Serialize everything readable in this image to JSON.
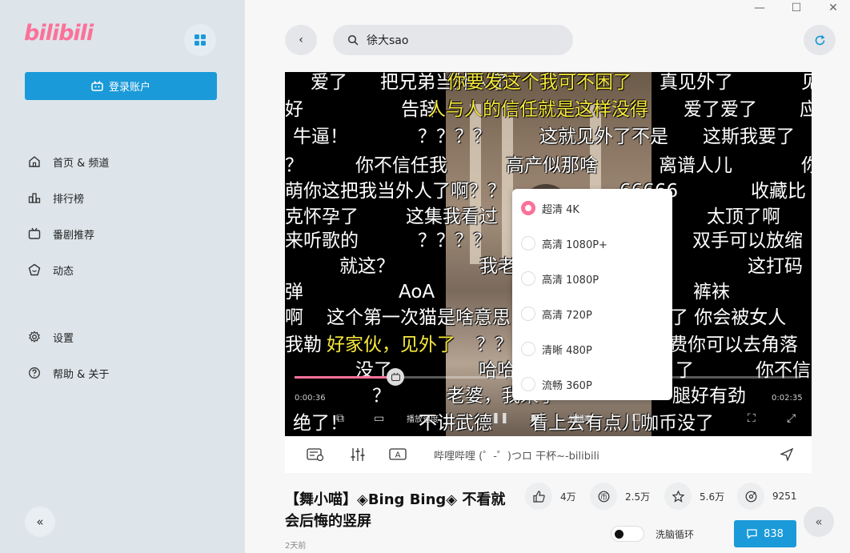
{
  "app": {
    "logo_text": "bilibili",
    "brand_color": "#fb7299",
    "accent_color": "#1a9ad9"
  },
  "sidebar": {
    "login_label": "登录账户",
    "items": [
      {
        "label": "首页 & 频道",
        "icon": "home-icon"
      },
      {
        "label": "排行榜",
        "icon": "ranking-icon"
      },
      {
        "label": "番剧推荐",
        "icon": "tv-icon"
      },
      {
        "label": "动态",
        "icon": "activity-icon"
      },
      {
        "label": "设置",
        "icon": "gear-icon"
      },
      {
        "label": "帮助 & 关于",
        "icon": "help-icon"
      }
    ],
    "collapse_label": "«"
  },
  "window": {
    "minimize": "—",
    "maximize": "☐",
    "close": "✕"
  },
  "header": {
    "back_label": "‹",
    "search_value": "徐大sao"
  },
  "player": {
    "danmaku": [
      {
        "text": "爱了",
        "color": "white"
      },
      {
        "text": "把兄弟当外人了",
        "color": "white"
      },
      {
        "text": "你要发这个我可不困了",
        "color": "yellow"
      },
      {
        "text": "真见外了",
        "color": "white"
      },
      {
        "text": "见",
        "color": "white"
      },
      {
        "text": "好",
        "color": "white"
      },
      {
        "text": "告辞",
        "color": "white"
      },
      {
        "text": "人与人的信任就是这样没得",
        "color": "yellow"
      },
      {
        "text": "爱了爱了",
        "color": "white"
      },
      {
        "text": "应",
        "color": "white"
      },
      {
        "text": "牛逼！",
        "color": "white"
      },
      {
        "text": "？？？？",
        "color": "white"
      },
      {
        "text": "这就见外了不是",
        "color": "white"
      },
      {
        "text": "这斯我要了",
        "color": "white"
      },
      {
        "text": "？",
        "color": "white"
      },
      {
        "text": "你不信任我",
        "color": "white"
      },
      {
        "text": "高产似那啥",
        "color": "white"
      },
      {
        "text": "离谱人儿",
        "color": "white"
      },
      {
        "text": "你",
        "color": "white"
      },
      {
        "text": "萌你这把我当外人了啊？？",
        "color": "white"
      },
      {
        "text": "66666",
        "color": "white"
      },
      {
        "text": "收藏比",
        "color": "white"
      },
      {
        "text": "克怀孕了",
        "color": "white"
      },
      {
        "text": "这集我看过",
        "color": "white"
      },
      {
        "text": "太顶了啊",
        "color": "white"
      },
      {
        "text": "来听歌的",
        "color": "white"
      },
      {
        "text": "？？？？",
        "color": "white"
      },
      {
        "text": "双手可以放缩",
        "color": "white"
      },
      {
        "text": "就这？",
        "color": "white"
      },
      {
        "text": "我老",
        "color": "white"
      },
      {
        "text": "这打码",
        "color": "white"
      },
      {
        "text": "弹",
        "color": "white"
      },
      {
        "text": "AoA",
        "color": "white"
      },
      {
        "text": "裤袜",
        "color": "white"
      },
      {
        "text": "啊",
        "color": "white"
      },
      {
        "text": "这个第一次猫是啥意思",
        "color": "white"
      },
      {
        "text": "力了 你会被女人",
        "color": "white"
      },
      {
        "text": "我勒",
        "color": "white"
      },
      {
        "text": "好家伙，见外了",
        "color": "yellow"
      },
      {
        "text": "？？",
        "color": "white"
      },
      {
        "text": "太费你可以去角落",
        "color": "white"
      },
      {
        "text": "没了",
        "color": "white"
      },
      {
        "text": "哈哈",
        "color": "white"
      },
      {
        "text": "了",
        "color": "white"
      },
      {
        "text": "你不信",
        "color": "white"
      },
      {
        "text": "？",
        "color": "white"
      },
      {
        "text": "老婆，我来了",
        "color": "white"
      },
      {
        "text": "腿好有劲",
        "color": "white"
      },
      {
        "text": "绝了！",
        "color": "white"
      },
      {
        "text": "不讲武德",
        "color": "white"
      },
      {
        "text": "看上去有点儿咖币没了",
        "color": "white"
      }
    ],
    "progress_fraction": 0.2,
    "time_current": "0:00:36",
    "time_total": "0:02:35",
    "controls": {
      "speed_label": "播放速度",
      "quality_label": "分辨率"
    },
    "quality_options": [
      {
        "label": "超清 4K",
        "selected": true
      },
      {
        "label": "高清 1080P+",
        "selected": false
      },
      {
        "label": "高清 1080P",
        "selected": false
      },
      {
        "label": "高清 720P",
        "selected": false
      },
      {
        "label": "清晰 480P",
        "selected": false
      },
      {
        "label": "流畅 360P",
        "selected": false
      }
    ]
  },
  "danmaku_bar": {
    "placeholder": "哔哩哔哩 (゜-゜)つロ 干杯~-bilibili"
  },
  "video": {
    "title": "【舞小喵】◈Bing Bing◈ 不看就会后悔的竖屏",
    "date": "2天前",
    "likes": "4万",
    "coins": "2.5万",
    "favorites": "5.6万",
    "shares": "9251",
    "loop_label": "洗脑循环",
    "comment_count": "838"
  }
}
